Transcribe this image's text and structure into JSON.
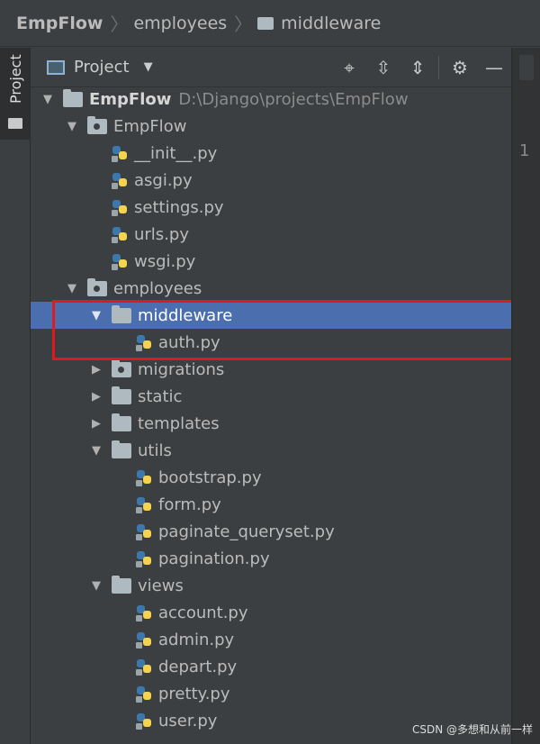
{
  "breadcrumb": {
    "items": [
      "EmpFlow",
      "employees",
      "middleware"
    ]
  },
  "toolstrip": {
    "project_label": "Project"
  },
  "panel": {
    "title": "Project",
    "icons": [
      "crosshair-icon",
      "expand-all-icon",
      "collapse-all-icon",
      "gear-icon",
      "minimize-icon"
    ]
  },
  "tree": {
    "root": {
      "name": "EmpFlow",
      "path": "D:\\Django\\projects\\EmpFlow"
    },
    "rows": [
      "EmpFlow",
      "__init__.py",
      "asgi.py",
      "settings.py",
      "urls.py",
      "wsgi.py",
      "employees",
      "middleware",
      "auth.py",
      "migrations",
      "static",
      "templates",
      "utils",
      "bootstrap.py",
      "form.py",
      "paginate_queryset.py",
      "pagination.py",
      "views",
      "account.py",
      "admin.py",
      "depart.py",
      "pretty.py",
      "user.py"
    ],
    "selected": "middleware"
  },
  "editor": {
    "line_number": "1"
  },
  "watermark": "CSDN @多想和从前一样",
  "colors": {
    "selection": "#4b6eaf",
    "highlight_box": "#e0191f"
  }
}
